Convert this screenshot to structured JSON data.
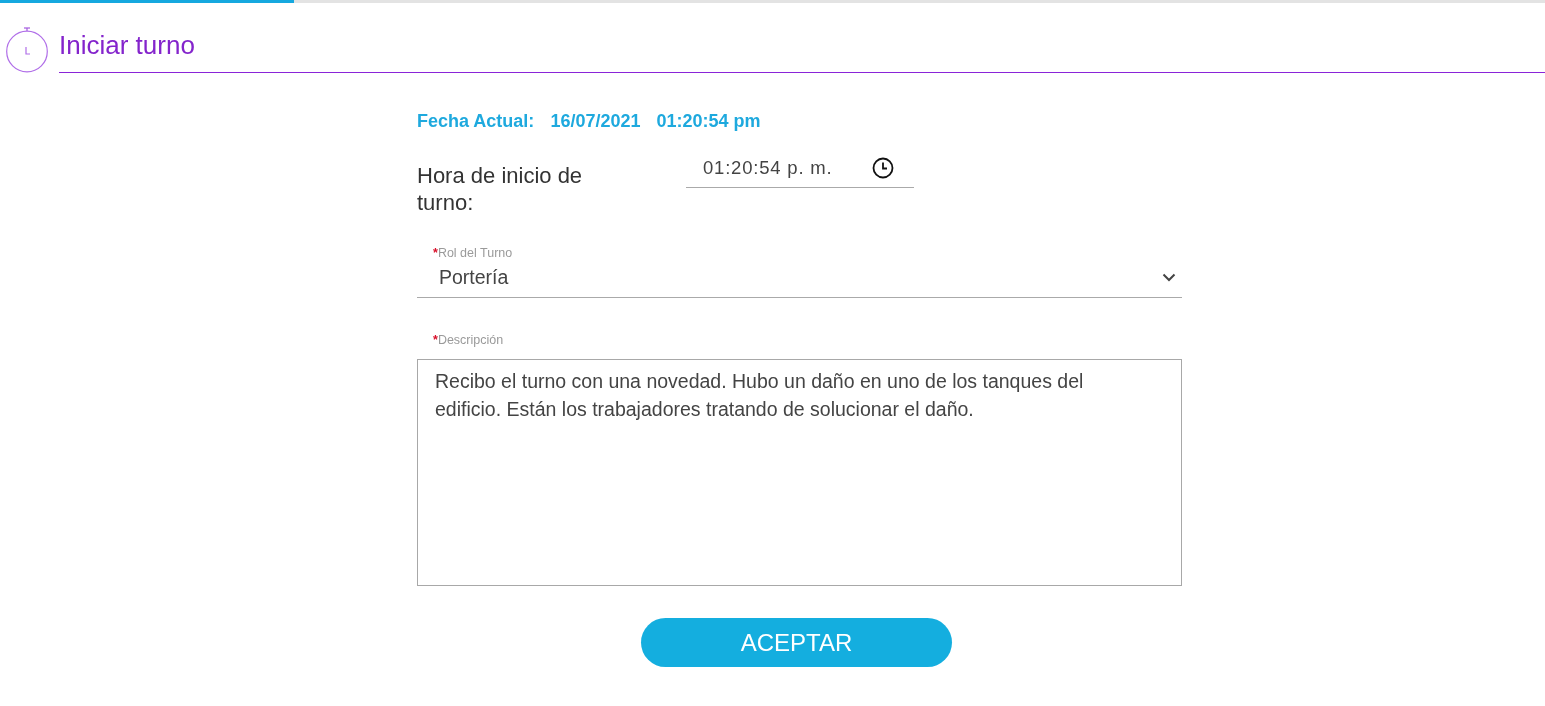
{
  "progress": {
    "level": 0.19
  },
  "header": {
    "title": "Iniciar turno"
  },
  "current": {
    "label": "Fecha Actual:",
    "date": "16/07/2021",
    "time": "01:20:54 pm"
  },
  "start_time": {
    "label": "Hora de inicio de turno:",
    "value": "01:20:54 p. m."
  },
  "fields": [
    {
      "kind": "select",
      "label": "Rol del Turno",
      "required_mark": "*",
      "value": "Portería"
    },
    {
      "kind": "textarea",
      "label": "Descripción",
      "required_mark": "*",
      "value": "Recibo el turno con una novedad. Hubo un daño en uno de los tanques del edificio. Están los trabajadores tratando de solucionar el daño."
    }
  ],
  "button": {
    "label": "ACEPTAR"
  }
}
